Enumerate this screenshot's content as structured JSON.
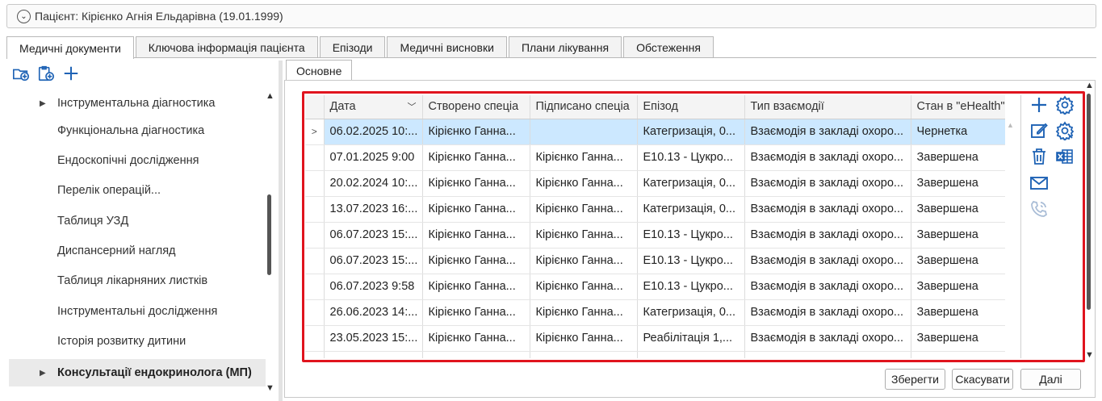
{
  "patient": {
    "label": "Пацієнт: Кірієнко Агнія Ельдарівна (19.01.1999)",
    "collapse_glyph": "⌄"
  },
  "tabs": [
    {
      "label": "Медичні документи",
      "active": true
    },
    {
      "label": "Ключова інформація пацієнта"
    },
    {
      "label": "Епізоди"
    },
    {
      "label": "Медичні висновки"
    },
    {
      "label": "Плани лікування"
    },
    {
      "label": "Обстеження"
    }
  ],
  "toolbar_left": {
    "icons": [
      "add-folder-icon",
      "add-clipboard-icon",
      "plus-icon"
    ],
    "accent": "#1f63b5"
  },
  "tree": {
    "items": [
      {
        "label": "Інструментальна діагностика",
        "expandable": true
      },
      {
        "label": "Функціональна діагностика"
      },
      {
        "label": "Ендоскопічні дослідження"
      },
      {
        "label": "Перелік операцій..."
      },
      {
        "label": "Таблиця УЗД"
      },
      {
        "label": "Диспансерний нагляд"
      },
      {
        "label": "Таблиця лікарняних листків"
      },
      {
        "label": "Інструментальні дослідження"
      },
      {
        "label": "Історія розвитку дитини"
      },
      {
        "label": "Консультації ендокринолога (МП)",
        "expandable": true,
        "selected": true
      }
    ]
  },
  "subtab": {
    "label": "Основне"
  },
  "grid": {
    "columns": [
      "Дата",
      "Створено спеціа",
      "Підписано спеціа",
      "Епізод",
      "Тип взаємодії",
      "Стан в \"eHealth\""
    ],
    "rows": [
      [
        "06.02.2025 10:...",
        "Кірієнко Ганна...",
        "",
        "Категризація, 0...",
        "Взаємодія в закладі охоро...",
        "Чернетка"
      ],
      [
        "07.01.2025 9:00",
        "Кірієнко Ганна...",
        "Кірієнко Ганна...",
        "E10.13 - Цукро...",
        "Взаємодія в закладі охоро...",
        "Завершена"
      ],
      [
        "20.02.2024 10:...",
        "Кірієнко Ганна...",
        "Кірієнко Ганна...",
        "Категризація, 0...",
        "Взаємодія в закладі охоро...",
        "Завершена"
      ],
      [
        "13.07.2023 16:...",
        "Кірієнко Ганна...",
        "Кірієнко Ганна...",
        "Категризація, 0...",
        "Взаємодія в закладі охоро...",
        "Завершена"
      ],
      [
        "06.07.2023 15:...",
        "Кірієнко Ганна...",
        "Кірієнко Ганна...",
        "E10.13 - Цукро...",
        "Взаємодія в закладі охоро...",
        "Завершена"
      ],
      [
        "06.07.2023 15:...",
        "Кірієнко Ганна...",
        "Кірієнко Ганна...",
        "E10.13 - Цукро...",
        "Взаємодія в закладі охоро...",
        "Завершена"
      ],
      [
        "06.07.2023 9:58",
        "Кірієнко Ганна...",
        "Кірієнко Ганна...",
        "E10.13 - Цукро...",
        "Взаємодія в закладі охоро...",
        "Завершена"
      ],
      [
        "26.06.2023 14:...",
        "Кірієнко Ганна...",
        "Кірієнко Ганна...",
        "Категризація, 0...",
        "Взаємодія в закладі охоро...",
        "Завершена"
      ],
      [
        "23.05.2023 15:...",
        "Кірієнко Ганна...",
        "Кірієнко Ганна...",
        "Реабілітація 1,...",
        "Взаємодія в закладі охоро...",
        "Завершена"
      ],
      [
        "",
        "",
        "",
        "",
        "",
        ""
      ]
    ],
    "selected_row": 0,
    "selection_color": "#cce8ff"
  },
  "actions": [
    "plus-icon",
    "settings-gear-icon",
    "edit-icon",
    "settings-gear-alt-icon",
    "trash-icon",
    "excel-export-icon",
    "mail-icon",
    "phone-icon"
  ],
  "highlight_color": "#e0141e",
  "buttons": {
    "save": "Зберегти",
    "cancel": "Скасувати",
    "next": "Далі"
  }
}
